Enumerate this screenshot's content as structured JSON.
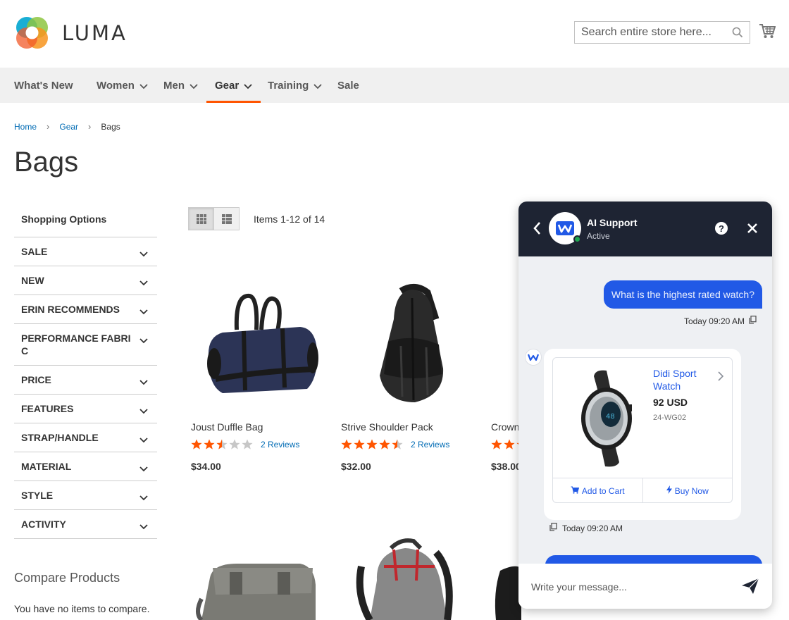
{
  "header": {
    "logo_text": "LUMA",
    "search_placeholder": "Search entire store here...",
    "brand_accent": "#ff5501"
  },
  "nav": {
    "items": [
      {
        "label": "What's New",
        "has_menu": false
      },
      {
        "label": "Women",
        "has_menu": true
      },
      {
        "label": "Men",
        "has_menu": true
      },
      {
        "label": "Gear",
        "has_menu": true,
        "active": true
      },
      {
        "label": "Training",
        "has_menu": true
      },
      {
        "label": "Sale",
        "has_menu": false
      }
    ]
  },
  "breadcrumb": {
    "items": [
      "Home",
      "Gear"
    ],
    "current": "Bags"
  },
  "page_title": "Bags",
  "sidebar": {
    "title": "Shopping Options",
    "filters": [
      "SALE",
      "NEW",
      "ERIN RECOMMENDS",
      "PERFORMANCE FABRI\nC",
      "PRICE",
      "FEATURES",
      "STRAP/HANDLE",
      "MATERIAL",
      "STYLE",
      "ACTIVITY"
    ],
    "compare_title": "Compare Products",
    "compare_empty": "You have no items to compare."
  },
  "toolbar": {
    "items_count": "Items 1-12 of 14",
    "modes": [
      "grid",
      "list"
    ],
    "active_mode": "grid"
  },
  "products": [
    {
      "name": "Joust Duffle Bag",
      "rating": 0.5,
      "reviews": "2  Reviews",
      "price": "$34.00"
    },
    {
      "name": "Strive Shoulder Pack",
      "rating": 0.9,
      "reviews": "2  Reviews",
      "price": "$32.00"
    },
    {
      "name": "Crown Summit Backpack",
      "price": "$38.00"
    }
  ],
  "chat": {
    "agent_name": "AI Support",
    "agent_status": "Active",
    "help_label": "?",
    "user_message": "What is the highest rated watch?",
    "user_time": "Today 09:20 AM",
    "product": {
      "name": "Didi Sport Watch",
      "price": "92 USD",
      "sku": "24-WG02",
      "add_to_cart": "Add to Cart",
      "buy_now": "Buy Now"
    },
    "bot_time": "Today 09:20 AM",
    "input_placeholder": "Write your message...",
    "accent": "#2159e6",
    "header_bg": "#1e2433"
  }
}
